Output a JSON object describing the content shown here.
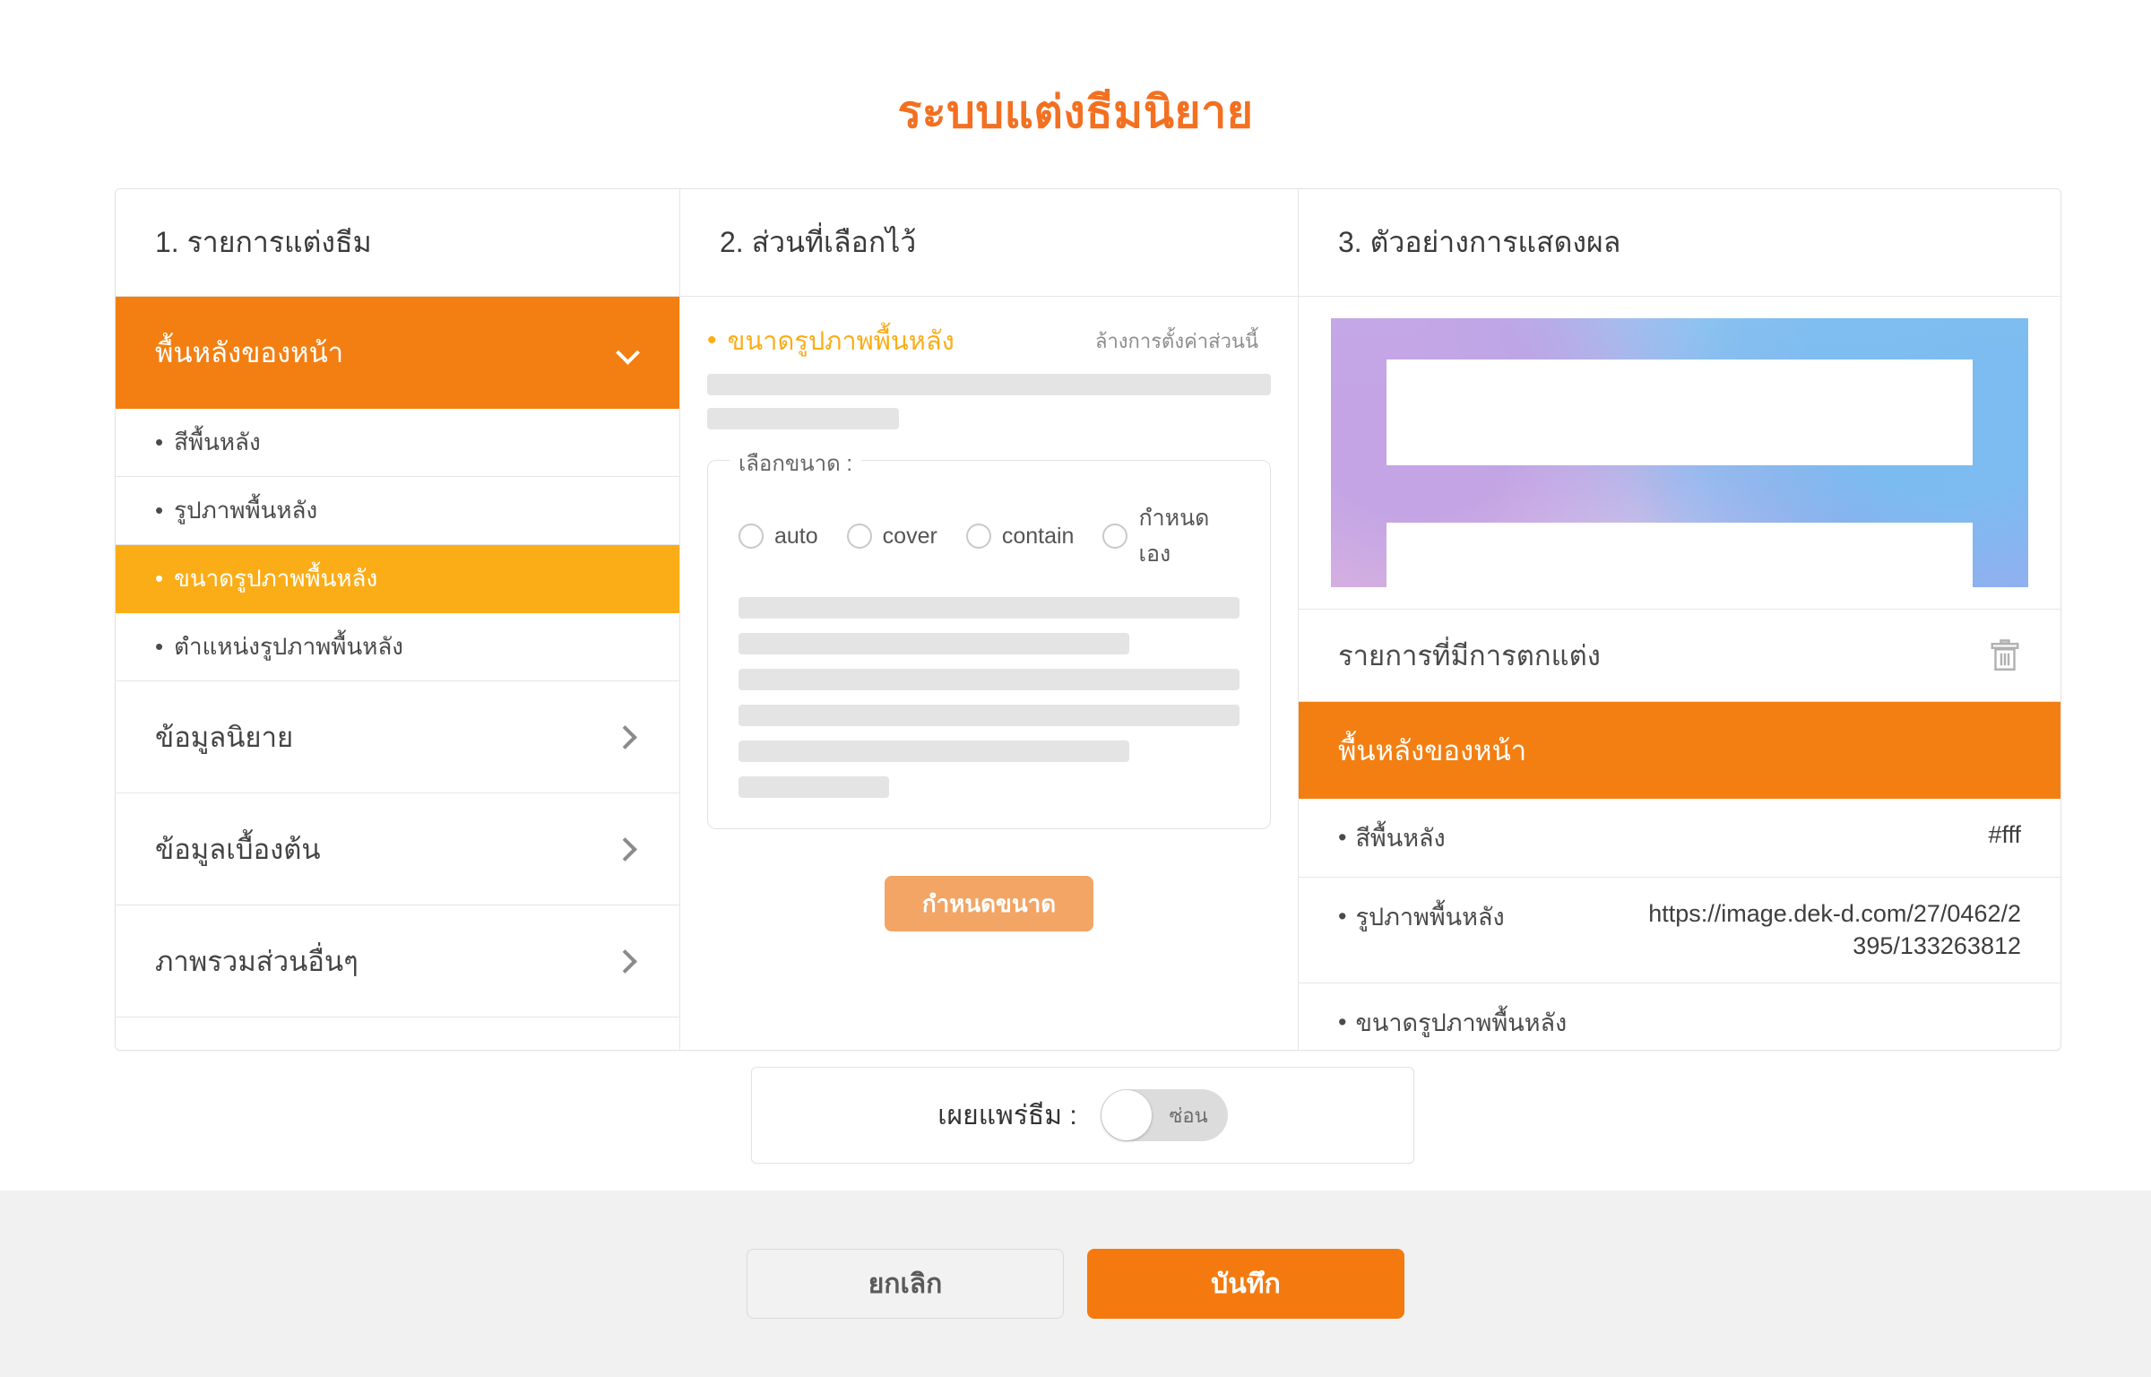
{
  "title": "ระบบแต่งธีมนิยาย",
  "accent": {
    "orange": "#F37021",
    "amber": "#FBAD18",
    "row_orange": "#F37F12",
    "save_orange": "#F47A10",
    "apply_orange": "#F2A565"
  },
  "panel1": {
    "header": "1. รายการแต่งธีม",
    "items": [
      {
        "label": "พื้นหลังของหน้า",
        "type": "group",
        "state": "active",
        "icon": "chevron-down-icon"
      },
      {
        "label": "สีพื้นหลัง",
        "type": "sub",
        "state": "normal",
        "bullet": "•"
      },
      {
        "label": "รูปภาพพื้นหลัง",
        "type": "sub",
        "state": "normal",
        "bullet": "•"
      },
      {
        "label": "ขนาดรูปภาพพื้นหลัง",
        "type": "sub",
        "state": "selected",
        "bullet": "•"
      },
      {
        "label": "ตำแหน่งรูปภาพพื้นหลัง",
        "type": "sub",
        "state": "normal",
        "bullet": "•"
      },
      {
        "label": "ข้อมูลนิยาย",
        "type": "group",
        "state": "normal",
        "icon": "chevron-right-icon"
      },
      {
        "label": "ข้อมูลเบื้องต้น",
        "type": "group",
        "state": "normal",
        "icon": "chevron-right-icon"
      },
      {
        "label": "ภาพรวมส่วนอื่นๆ",
        "type": "group",
        "state": "normal",
        "icon": "chevron-right-icon"
      }
    ]
  },
  "panel2": {
    "header": "2. ส่วนที่เลือกไว้",
    "selected_label": "ขนาดรูปภาพพื้นหลัง",
    "bullet": "•",
    "clear_link": "ล้างการตั้งค่าส่วนนี้",
    "top_skeletons": [
      100,
      34
    ],
    "fieldset": {
      "legend": "เลือกขนาด :",
      "options": [
        {
          "label": "auto",
          "checked": false
        },
        {
          "label": "cover",
          "checked": false
        },
        {
          "label": "contain",
          "checked": false
        },
        {
          "label": "กำหนดเอง",
          "checked": false
        }
      ],
      "skeletons": [
        100,
        78,
        100,
        100,
        78,
        30
      ]
    },
    "apply_button": "กำหนดขนาด"
  },
  "panel3": {
    "header": "3. ตัวอย่างการแสดงผล",
    "preview_name": "theme-preview-image",
    "decorated_title": "รายการที่มีการตกแต่ง",
    "delete_icon": "trash-icon",
    "active_group": "พื้นหลังของหน้า",
    "rows": [
      {
        "bullet": "•",
        "key": "สีพื้นหลัง",
        "value": "#fff"
      },
      {
        "bullet": "•",
        "key": "รูปภาพพื้นหลัง",
        "value": "https://image.dek-d.com/27/0462/2395/133263812"
      },
      {
        "bullet": "•",
        "key": "ขนาดรูปภาพพื้นหลัง",
        "value": ""
      }
    ]
  },
  "publish": {
    "label": "เผยแพร่ธีม :",
    "toggle_state_text": "ซ่อน",
    "toggle_on": false
  },
  "footer": {
    "cancel": "ยกเลิก",
    "save": "บันทึก"
  }
}
